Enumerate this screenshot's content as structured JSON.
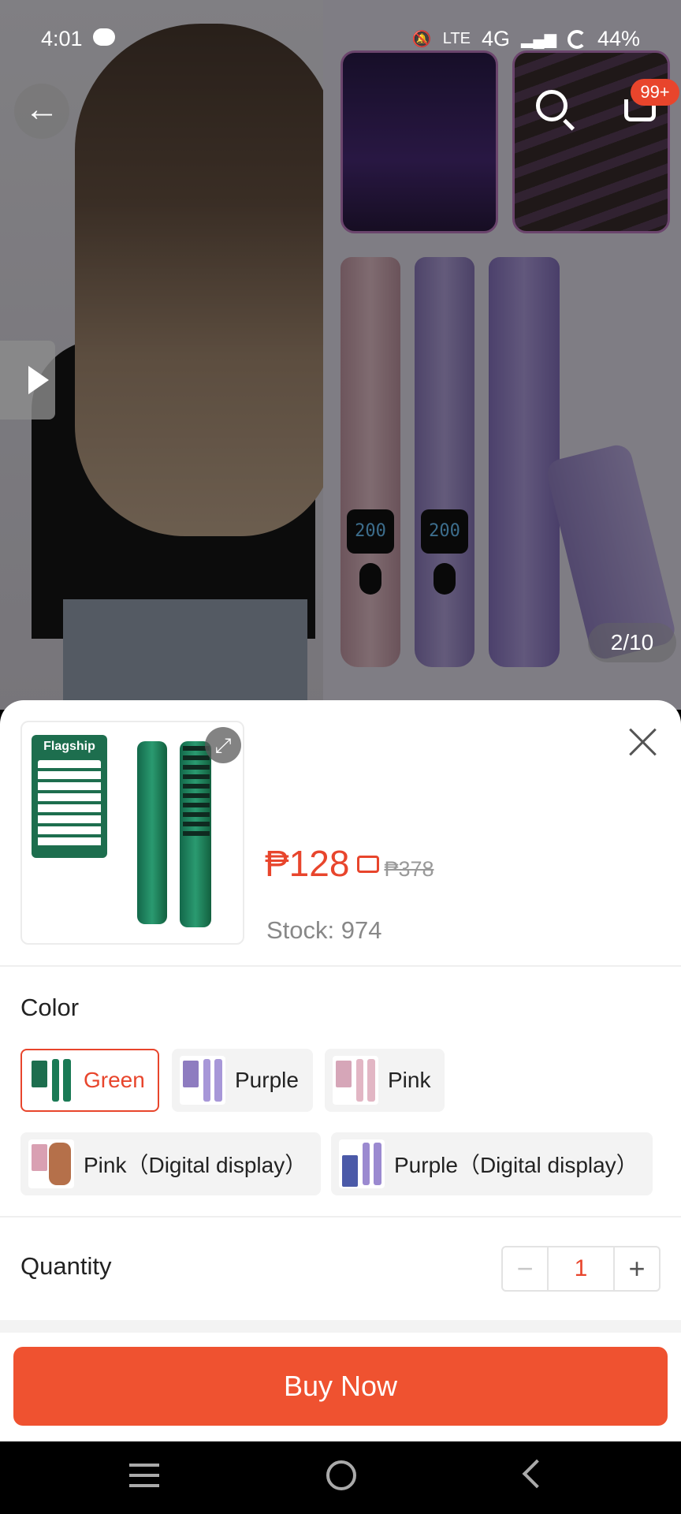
{
  "status_bar": {
    "time": "4:01",
    "network": "4G",
    "lte_label": "LTE",
    "battery": "44%"
  },
  "gallery": {
    "page_indicator": "2/10",
    "cart_badge": "99+",
    "wand_display_value": "200",
    "icons": [
      "back-arrow-icon",
      "search-icon",
      "cart-icon",
      "play-icon"
    ]
  },
  "sheet": {
    "thumb_card_title": "Flagship",
    "price": "₱128",
    "original_price": "₱378",
    "stock": "Stock: 974",
    "color_label": "Color",
    "colors": [
      {
        "label": "Green",
        "selected": true
      },
      {
        "label": "Purple",
        "selected": false
      },
      {
        "label": "Pink",
        "selected": false
      },
      {
        "label": "Pink（Digital display）",
        "selected": false
      },
      {
        "label": "Purple（Digital display）",
        "selected": false
      }
    ],
    "quantity_label": "Quantity",
    "quantity_minus": "−",
    "quantity_value": "1",
    "quantity_plus": "+",
    "buy_button": "Buy Now"
  },
  "colors": {
    "accent": "#e8452c",
    "buy_button": "#ef5230"
  }
}
